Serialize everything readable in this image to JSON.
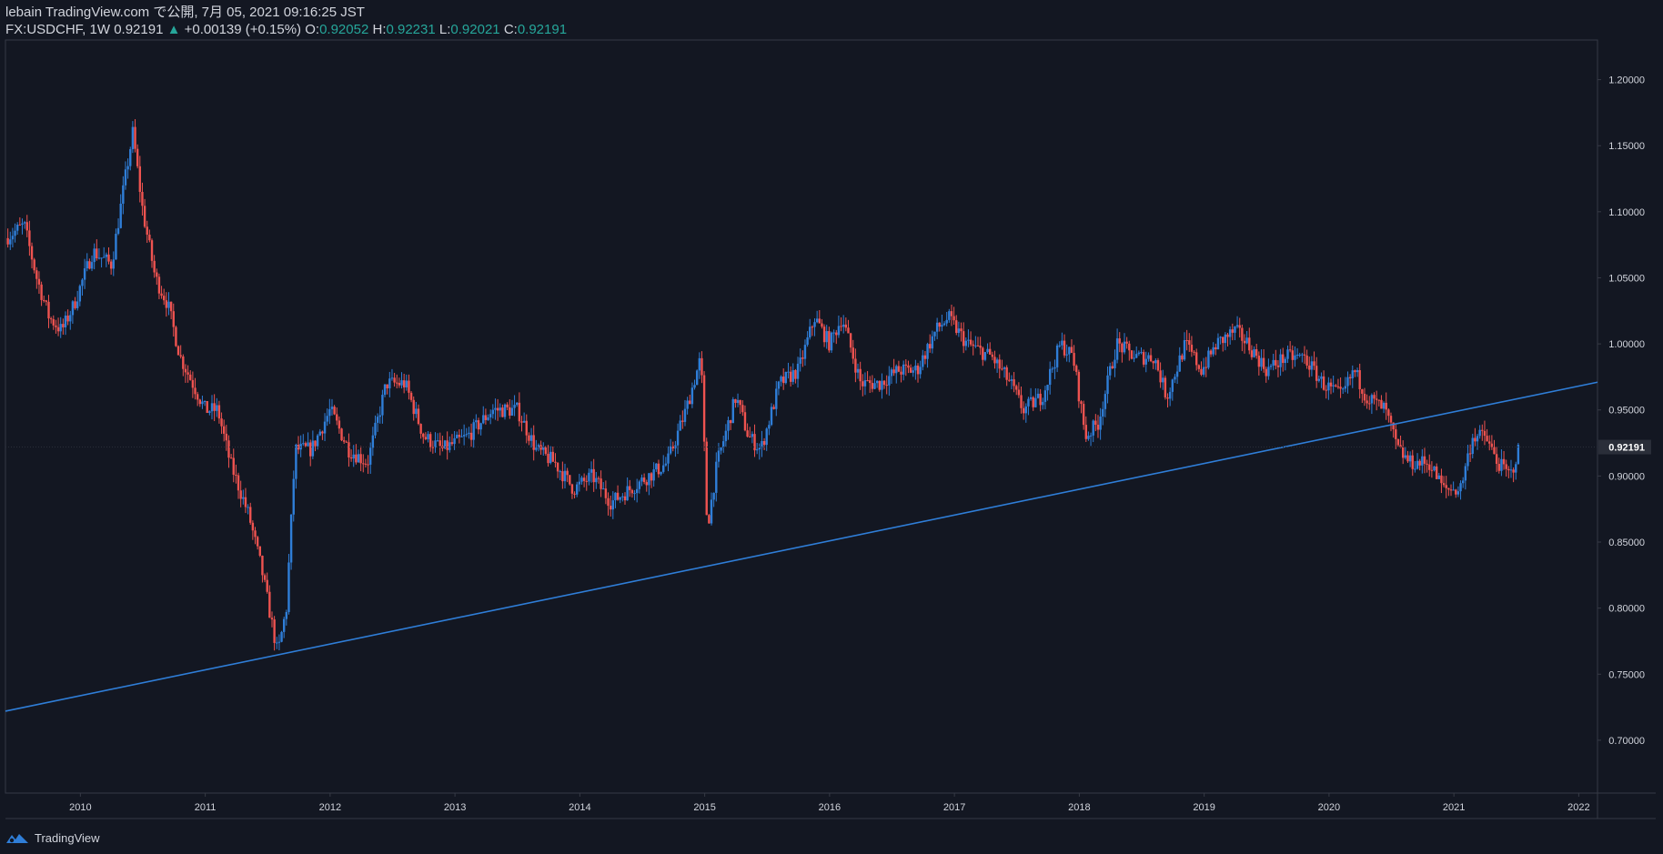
{
  "header": {
    "publisher": "lebain TradingView.com で公開, 7月 05, 2021 09:16:25 JST",
    "symbol": "FX:USDCHF, 1W",
    "last": "0.92191",
    "change_arrow": "▲",
    "change": "+0.00139 (+0.15%)",
    "o_label": "O:",
    "o_value": "0.92052",
    "h_label": "H:",
    "h_value": "0.92231",
    "l_label": "L:",
    "l_value": "0.92021",
    "c_label": "C:",
    "c_value": "0.92191"
  },
  "footer": {
    "brand": "TradingView",
    "logo_icon": "tradingview-logo-icon"
  },
  "colors": {
    "background": "#131722",
    "up": "#2f7ed8",
    "down": "#ef5350",
    "trendline": "#2f7ed8",
    "axis_text": "#d1d4dc",
    "border": "#363a45",
    "price_tag_bg": "#2a2e39"
  },
  "chart_data": {
    "type": "candlestick",
    "symbol": "FX:USDCHF",
    "interval": "1W",
    "ylim": [
      0.66,
      1.23
    ],
    "y_ticks": [
      "1.20000",
      "1.15000",
      "1.10000",
      "1.05000",
      "1.00000",
      "0.95000",
      "0.90000",
      "0.85000",
      "0.80000",
      "0.75000",
      "0.70000"
    ],
    "x_ticks": [
      "2010",
      "2011",
      "2012",
      "2013",
      "2014",
      "2015",
      "2016",
      "2017",
      "2018",
      "2019",
      "2020",
      "2021",
      "2022"
    ],
    "xlim": [
      2009.4,
      2022.15
    ],
    "current_price": "0.92191",
    "trendline": {
      "points": [
        [
          2009.4,
          0.722
        ],
        [
          2022.15,
          0.971
        ]
      ]
    },
    "price_path": [
      [
        2009.4,
        1.08
      ],
      [
        2009.55,
        1.09
      ],
      [
        2009.65,
        1.05
      ],
      [
        2009.75,
        1.02
      ],
      [
        2009.85,
        1.01
      ],
      [
        2009.95,
        1.03
      ],
      [
        2010.1,
        1.07
      ],
      [
        2010.25,
        1.06
      ],
      [
        2010.35,
        1.12
      ],
      [
        2010.42,
        1.16
      ],
      [
        2010.5,
        1.1
      ],
      [
        2010.6,
        1.05
      ],
      [
        2010.7,
        1.03
      ],
      [
        2010.8,
        0.99
      ],
      [
        2010.9,
        0.97
      ],
      [
        2011.0,
        0.95
      ],
      [
        2011.1,
        0.95
      ],
      [
        2011.2,
        0.91
      ],
      [
        2011.35,
        0.87
      ],
      [
        2011.45,
        0.83
      ],
      [
        2011.58,
        0.765
      ],
      [
        2011.65,
        0.8
      ],
      [
        2011.72,
        0.92
      ],
      [
        2011.85,
        0.92
      ],
      [
        2012.0,
        0.95
      ],
      [
        2012.15,
        0.92
      ],
      [
        2012.3,
        0.91
      ],
      [
        2012.45,
        0.97
      ],
      [
        2012.6,
        0.97
      ],
      [
        2012.75,
        0.93
      ],
      [
        2012.9,
        0.92
      ],
      [
        2013.1,
        0.93
      ],
      [
        2013.3,
        0.95
      ],
      [
        2013.5,
        0.95
      ],
      [
        2013.65,
        0.92
      ],
      [
        2013.8,
        0.91
      ],
      [
        2013.95,
        0.89
      ],
      [
        2014.1,
        0.9
      ],
      [
        2014.25,
        0.88
      ],
      [
        2014.4,
        0.89
      ],
      [
        2014.55,
        0.9
      ],
      [
        2014.7,
        0.91
      ],
      [
        2014.85,
        0.95
      ],
      [
        2014.97,
        0.99
      ],
      [
        2015.02,
        0.86
      ],
      [
        2015.1,
        0.91
      ],
      [
        2015.25,
        0.96
      ],
      [
        2015.35,
        0.93
      ],
      [
        2015.45,
        0.92
      ],
      [
        2015.6,
        0.97
      ],
      [
        2015.75,
        0.98
      ],
      [
        2015.88,
        1.02
      ],
      [
        2016.0,
        1.0
      ],
      [
        2016.1,
        1.02
      ],
      [
        2016.25,
        0.97
      ],
      [
        2016.4,
        0.97
      ],
      [
        2016.55,
        0.98
      ],
      [
        2016.7,
        0.98
      ],
      [
        2016.85,
        1.01
      ],
      [
        2016.95,
        1.02
      ],
      [
        2017.1,
        1.0
      ],
      [
        2017.3,
        0.99
      ],
      [
        2017.45,
        0.97
      ],
      [
        2017.55,
        0.95
      ],
      [
        2017.7,
        0.96
      ],
      [
        2017.85,
        1.0
      ],
      [
        2017.95,
        0.99
      ],
      [
        2018.05,
        0.93
      ],
      [
        2018.15,
        0.94
      ],
      [
        2018.3,
        1.0
      ],
      [
        2018.45,
        0.99
      ],
      [
        2018.6,
        0.99
      ],
      [
        2018.7,
        0.96
      ],
      [
        2018.85,
        1.0
      ],
      [
        2018.98,
        0.98
      ],
      [
        2019.1,
        1.0
      ],
      [
        2019.25,
        1.01
      ],
      [
        2019.35,
        1.0
      ],
      [
        2019.5,
        0.98
      ],
      [
        2019.65,
        0.99
      ],
      [
        2019.8,
        0.99
      ],
      [
        2019.95,
        0.97
      ],
      [
        2020.1,
        0.96
      ],
      [
        2020.2,
        0.98
      ],
      [
        2020.3,
        0.96
      ],
      [
        2020.45,
        0.95
      ],
      [
        2020.55,
        0.92
      ],
      [
        2020.65,
        0.91
      ],
      [
        2020.8,
        0.91
      ],
      [
        2020.92,
        0.89
      ],
      [
        2021.05,
        0.89
      ],
      [
        2021.15,
        0.93
      ],
      [
        2021.25,
        0.93
      ],
      [
        2021.35,
        0.91
      ],
      [
        2021.45,
        0.9
      ],
      [
        2021.52,
        0.92
      ]
    ]
  }
}
